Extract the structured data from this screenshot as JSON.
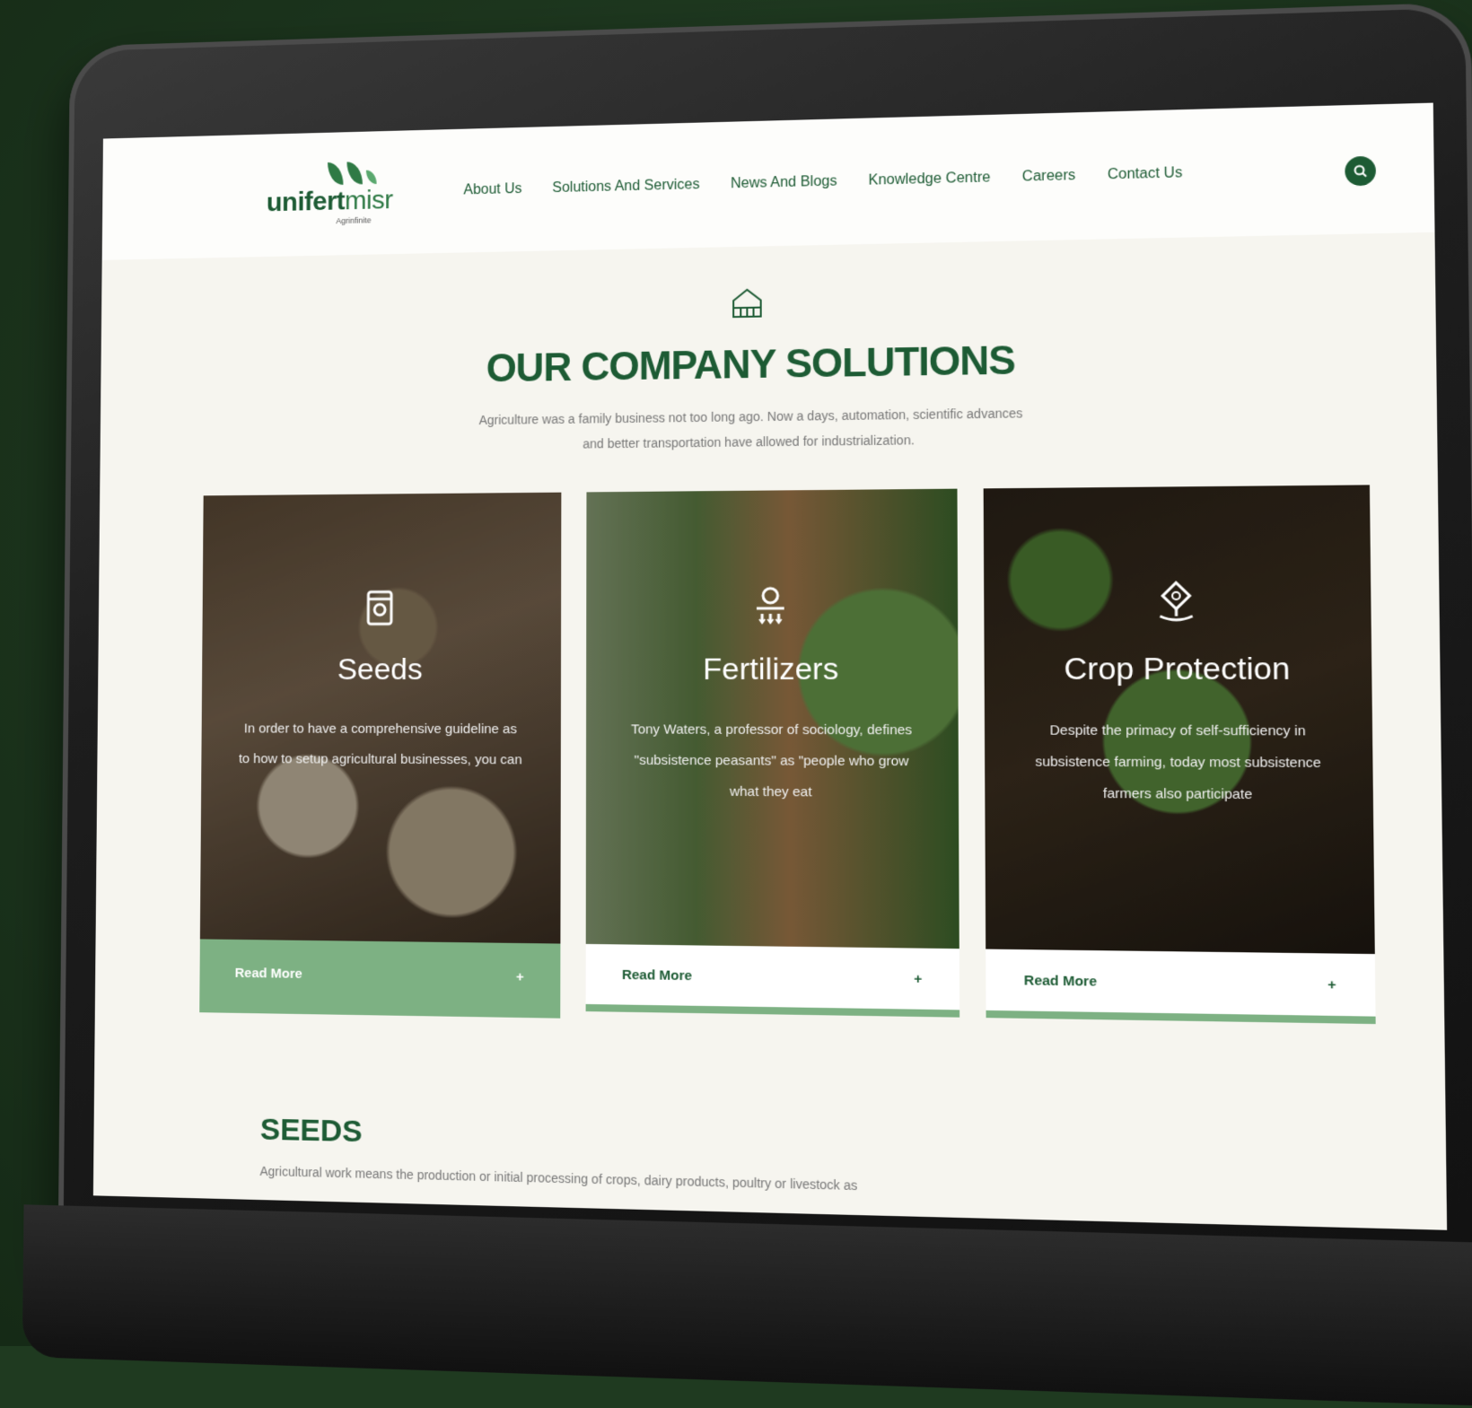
{
  "nav": {
    "logo": {
      "main_bold": "unifert",
      "main_rest": "misr",
      "sub": "Agrinfinite"
    },
    "items": [
      "About Us",
      "Solutions And Services",
      "News And Blogs",
      "Knowledge Centre",
      "Careers",
      "Contact Us"
    ],
    "search_icon": "search-icon"
  },
  "hero": {
    "icon": "greenhouse-icon",
    "title": "OUR COMPANY SOLUTIONS",
    "subtitle": "Agriculture was a family business not too long ago. Now a days, automation, scientific advances and better transportation have allowed for industrialization."
  },
  "cards": [
    {
      "icon": "seed-bag-icon",
      "title": "Seeds",
      "text": "In order to have a comprehensive guideline as to how to setup agricultural businesses, you can",
      "cta": "Read More"
    },
    {
      "icon": "fertilizer-icon",
      "title": "Fertilizers",
      "text": "Tony Waters, a professor of sociology, defines \"subsistence peasants\" as \"people who grow what they eat",
      "cta": "Read More"
    },
    {
      "icon": "crop-protection-icon",
      "title": "Crop Protection",
      "text": "Despite the primacy of self-sufficiency in subsistence farming, today most subsistence farmers also participate",
      "cta": "Read More"
    }
  ],
  "seeds_section": {
    "title": "SEEDS",
    "text": "Agricultural work means the production or initial processing of crops, dairy products, poultry or livestock as"
  },
  "colors": {
    "brand_green": "#1d5b34",
    "accent_green": "#7db183",
    "page_bg": "#1f3a20"
  }
}
